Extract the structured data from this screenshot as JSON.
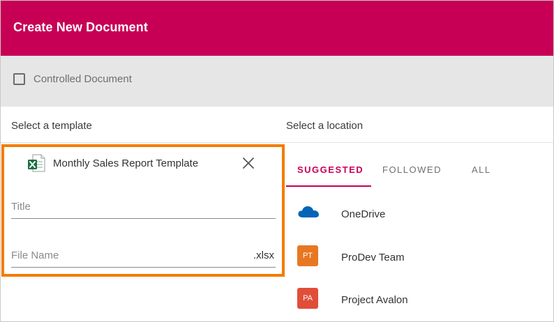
{
  "header": {
    "title": "Create New Document"
  },
  "controlled": {
    "label": "Controlled Document",
    "checked": false
  },
  "template_section": {
    "label": "Select a template",
    "selected_template": "Monthly Sales Report Template",
    "title_placeholder": "Title",
    "filename_placeholder": "File Name",
    "extension": ".xlsx"
  },
  "location_section": {
    "label": "Select a location",
    "tabs": [
      {
        "label": "SUGGESTED",
        "active": true
      },
      {
        "label": "FOLLOWED",
        "active": false
      },
      {
        "label": "ALL",
        "active": false
      }
    ],
    "locations": [
      {
        "name": "OneDrive",
        "icon": "onedrive-cloud-icon"
      },
      {
        "name": "ProDev Team",
        "initials": "PT",
        "color": "#e87722"
      },
      {
        "name": "Project Avalon",
        "initials": "PA",
        "color": "#e04e39"
      }
    ]
  },
  "colors": {
    "header": "#c70055",
    "highlight_border": "#f57c00",
    "excel_green": "#1d7044",
    "onedrive_blue": "#0364b8"
  }
}
